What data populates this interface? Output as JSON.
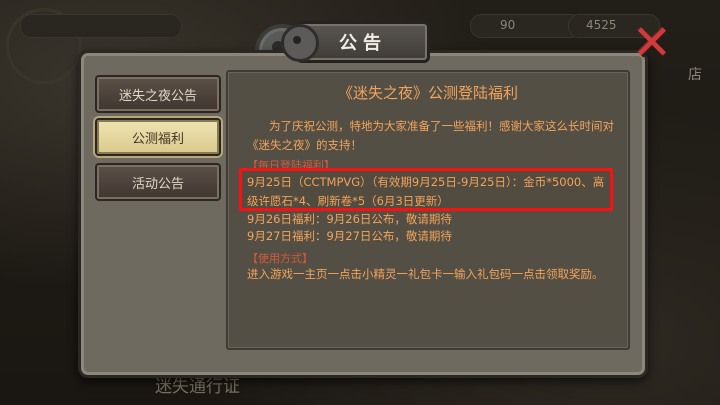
{
  "background": {
    "top_right_count": "90",
    "top_right_value": "4525",
    "corner_text": "店",
    "footer_text": "迷失通行证"
  },
  "dialog": {
    "title": "公告",
    "close_icon": "close-x-icon"
  },
  "tabs": [
    {
      "label": "迷失之夜公告",
      "active": false
    },
    {
      "label": "公测福利",
      "active": true
    },
    {
      "label": "活动公告",
      "active": false
    }
  ],
  "content": {
    "title": "《迷失之夜》公测登陆福利",
    "intro": "为了庆祝公测，特地为大家准备了一些福利！感谢大家这么长时间对《迷失之夜》的支持！",
    "section1_head": "【每日登陆福利】",
    "benefits": [
      "9月25日（CCTMPVG）（有效期9月25日-9月25日）：金币*5000、高级许愿石*4、刷新卷*5（6月3日更新）",
      "9月26日福利：9月26日公布，敬请期待",
      "9月27日福利：9月27日公布，敬请期待"
    ],
    "section2_head": "【使用方式】",
    "usage": "进入游戏一主页一点击小精灵一礼包卡一输入礼包码一点击领取奖励。"
  },
  "colors": {
    "accent_text": "#f2a35a",
    "section_head": "#d45a3c",
    "highlight": "#ff1010"
  }
}
